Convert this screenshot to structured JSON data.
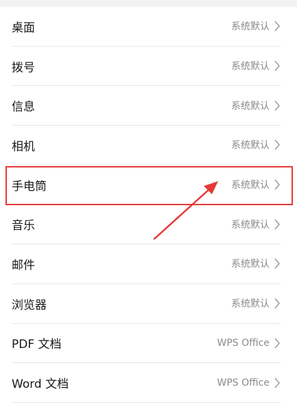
{
  "settings": {
    "items": [
      {
        "label": "桌面",
        "value": "系统默认"
      },
      {
        "label": "拨号",
        "value": "系统默认"
      },
      {
        "label": "信息",
        "value": "系统默认"
      },
      {
        "label": "相机",
        "value": "系统默认"
      },
      {
        "label": "手电筒",
        "value": "系统默认"
      },
      {
        "label": "音乐",
        "value": "系统默认"
      },
      {
        "label": "邮件",
        "value": "系统默认"
      },
      {
        "label": "浏览器",
        "value": "系统默认"
      },
      {
        "label": "PDF 文档",
        "value": "WPS Office"
      },
      {
        "label": "Word 文档",
        "value": "WPS Office"
      }
    ]
  },
  "annotation": {
    "highlight_color": "#e53935",
    "highlighted_item": "手电筒"
  },
  "colors": {
    "label": "#1a1a1a",
    "value": "#8a8a8a",
    "divider": "#e6e6e6"
  }
}
